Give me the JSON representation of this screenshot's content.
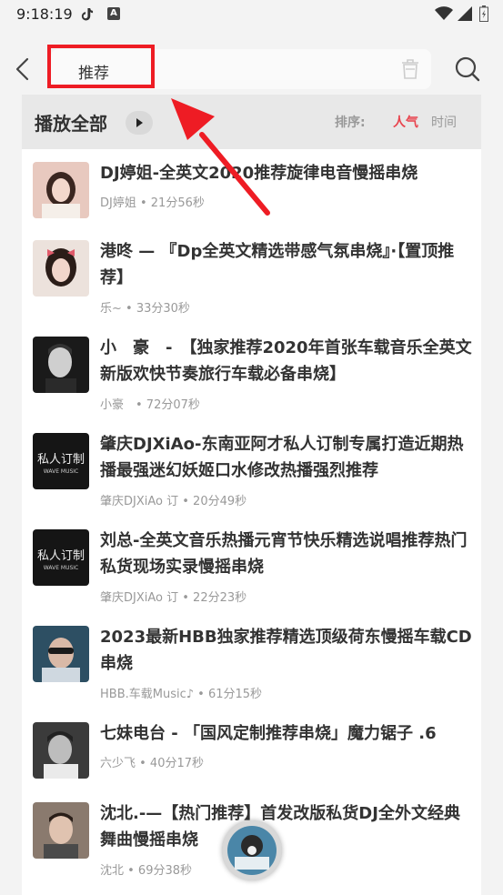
{
  "status_bar": {
    "time": "9:18:19",
    "icons": [
      "tiktok-icon",
      "a-icon",
      "wifi-icon",
      "signal-icon",
      "battery-icon"
    ],
    "badge_letter": "A"
  },
  "search": {
    "query": "推荐",
    "back_icon": "chevron-left-icon",
    "clear_icon": "trash-icon",
    "search_icon": "search-icon"
  },
  "list_header": {
    "play_all": "播放全部",
    "sort_label": "排序:",
    "sort_hot": "人气",
    "sort_time": "时间"
  },
  "items": [
    {
      "title": "DJ婷姐-全英文2020推荐旋律电音慢摇串烧",
      "meta": "DJ婷姐 • 21分56秒"
    },
    {
      "title": "港咚 — 『Dp全英文精选带感气氛串烧』·【置顶推荐】",
      "meta": "乐~ • 33分30秒"
    },
    {
      "title": "小　豪　-　【独家推荐2020年首张车载音乐全英文新版欢快节奏旅行车载必备串烧】",
      "meta": "小豪　• 72分07秒"
    },
    {
      "title": "肇庆DJXiAo-东南亚阿才私人订制专属打造近期热播最强迷幻妖姬口水修改热播强烈推荐",
      "meta": "肇庆DJXiAo 订 • 20分49秒"
    },
    {
      "title": "刘总-全英文音乐热播元宵节快乐精选说唱推荐热门私货现场实录慢摇串烧",
      "meta": "肇庆DJXiAo 订 • 22分23秒"
    },
    {
      "title": "2023最新HBB独家推荐精选顶级荷东慢摇车载CD串烧",
      "meta": "HBB.车载Music♪ • 61分15秒"
    },
    {
      "title": "七妹电台 - 「国风定制推荐串烧」魔力锯子 .6",
      "meta": "六少飞 • 40分17秒"
    },
    {
      "title": "沈北.-—【热门推荐】首发改版私货DJ全外文经典舞曲慢摇串烧",
      "meta": "沈北 • 69分38秒"
    }
  ],
  "thumb_text": {
    "line1": "私人订制",
    "line2": "WAVE MUSIC"
  },
  "annotation": {
    "color": "#ee1c24"
  }
}
